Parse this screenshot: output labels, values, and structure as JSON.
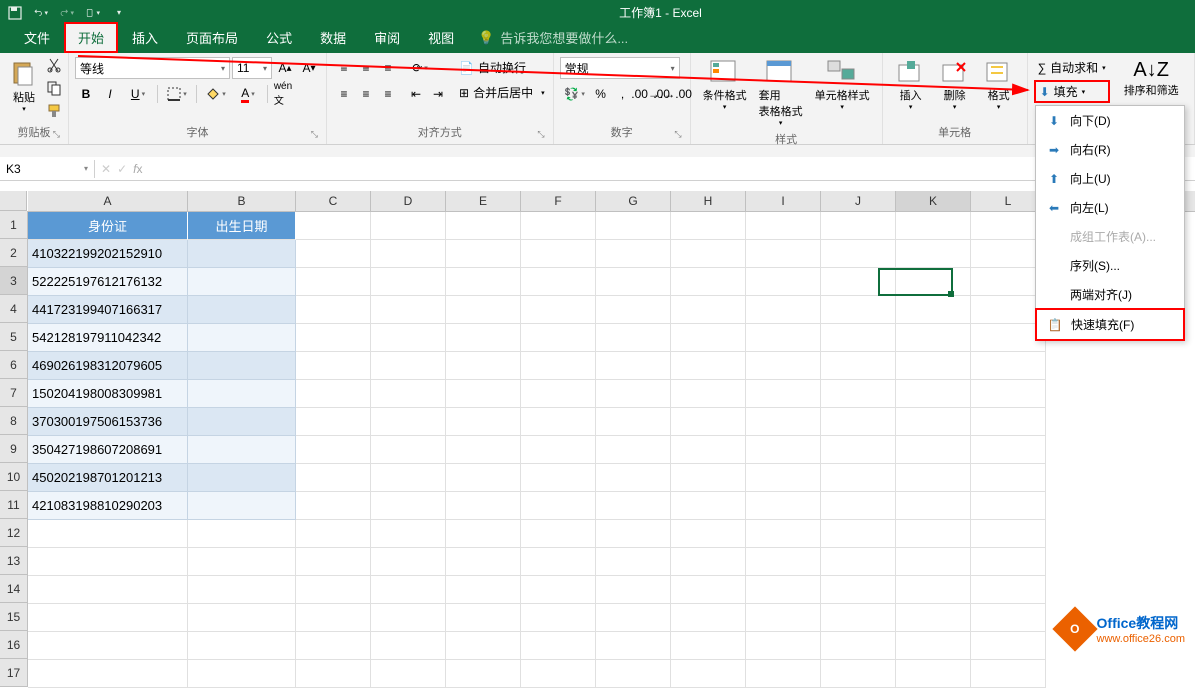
{
  "title": "工作簿1 - Excel",
  "tabs": {
    "file": "文件",
    "home": "开始",
    "insert": "插入",
    "layout": "页面布局",
    "formulas": "公式",
    "data": "数据",
    "review": "审阅",
    "view": "视图"
  },
  "tell_me": "告诉我您想要做什么...",
  "ribbon": {
    "clipboard": {
      "label": "剪贴板",
      "paste": "粘贴"
    },
    "font": {
      "label": "字体",
      "name": "等线",
      "size": "11"
    },
    "alignment": {
      "label": "对齐方式",
      "wrap": "自动换行",
      "merge": "合并后居中"
    },
    "number": {
      "label": "数字",
      "format": "常规"
    },
    "styles": {
      "label": "样式",
      "cond": "条件格式",
      "table": "套用\n表格格式",
      "cell": "单元格样式"
    },
    "cells": {
      "label": "单元格",
      "insert": "插入",
      "delete": "删除",
      "format": "格式"
    },
    "editing": {
      "autosum": "自动求和",
      "fill": "填充",
      "sort": "排序和筛选"
    }
  },
  "fill_menu": {
    "down": "向下(D)",
    "right": "向右(R)",
    "up": "向上(U)",
    "left": "向左(L)",
    "across": "成组工作表(A)...",
    "series": "序列(S)...",
    "justify": "两端对齐(J)",
    "flash": "快速填充(F)"
  },
  "name_box": "K3",
  "columns": [
    "A",
    "B",
    "C",
    "D",
    "E",
    "F",
    "G",
    "H",
    "I",
    "J",
    "K",
    "L"
  ],
  "rows": [
    "1",
    "2",
    "3",
    "4",
    "5",
    "6",
    "7",
    "8",
    "9",
    "10",
    "11",
    "12",
    "13",
    "14",
    "15",
    "16",
    "17"
  ],
  "headers": {
    "a": "身份证",
    "b": "出生日期"
  },
  "data_a": [
    "410322199202152910",
    "522225197612176132",
    "441723199407166317",
    "542128197911042342",
    "469026198312079605",
    "150204198008309981",
    "370300197506153736",
    "350427198607208691",
    "450202198701201213",
    "421083198810290203"
  ],
  "watermark": {
    "t1": "Office教程网",
    "t2": "www.office26.com"
  }
}
